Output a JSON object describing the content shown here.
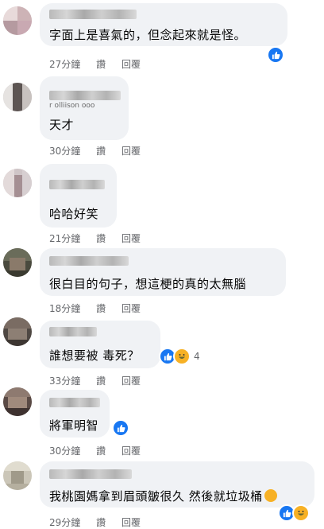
{
  "actions": {
    "like": "讚",
    "reply": "回覆"
  },
  "comments": [
    {
      "text": "字面上是喜氣的，但念起來就是怪。",
      "time": "27分鐘",
      "reaction_count": ""
    },
    {
      "subtext": "r olliison ooo",
      "text": "天才",
      "time": "30分鐘",
      "reaction_count": ""
    },
    {
      "text": "哈哈好笑",
      "time": "21分鐘",
      "reaction_count": ""
    },
    {
      "text": "很白目的句子，想這梗的真的太無腦",
      "time": "18分鐘",
      "reaction_count": ""
    },
    {
      "text": "誰想要被 毒死？",
      "time": "33分鐘",
      "reaction_count": "4"
    },
    {
      "text": "將軍明智",
      "time": "30分鐘",
      "reaction_count": ""
    },
    {
      "text": "我桃園媽拿到眉頭皺很久 然後就垃圾桶",
      "time": "29分鐘",
      "reaction_count": ""
    }
  ],
  "icons": {
    "like": "like-reaction-icon",
    "haha": "haha-reaction-icon"
  },
  "colors": {
    "bubble": "#f0f2f5",
    "meta_text": "#65676b",
    "like_blue": "#1877f2",
    "haha_yellow": "#f7b125"
  }
}
